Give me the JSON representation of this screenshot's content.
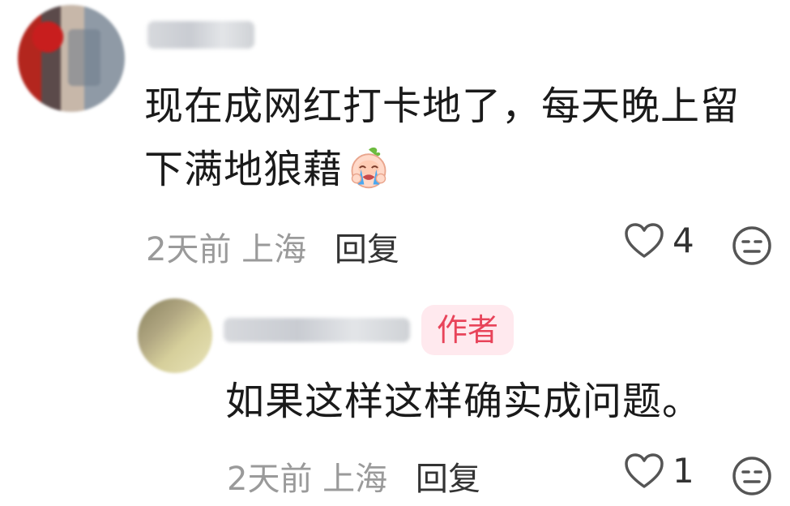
{
  "comment": {
    "text_line1": "现在成网红打卡地了，每天晚上留",
    "text_line2": "下满地狼藉",
    "emoji": "crying-face-icon",
    "meta": {
      "time": "2天前",
      "location": "上海",
      "reply_label": "回复"
    },
    "likes": "4"
  },
  "reply": {
    "author_badge": "作者",
    "text": "如果这样这样确实成问题。",
    "meta": {
      "time": "2天前",
      "location": "上海",
      "reply_label": "回复"
    },
    "likes": "1"
  },
  "colors": {
    "badge_bg": "#ffe9ee",
    "badge_text": "#e8445a",
    "meta_text": "#9a9a9a"
  }
}
